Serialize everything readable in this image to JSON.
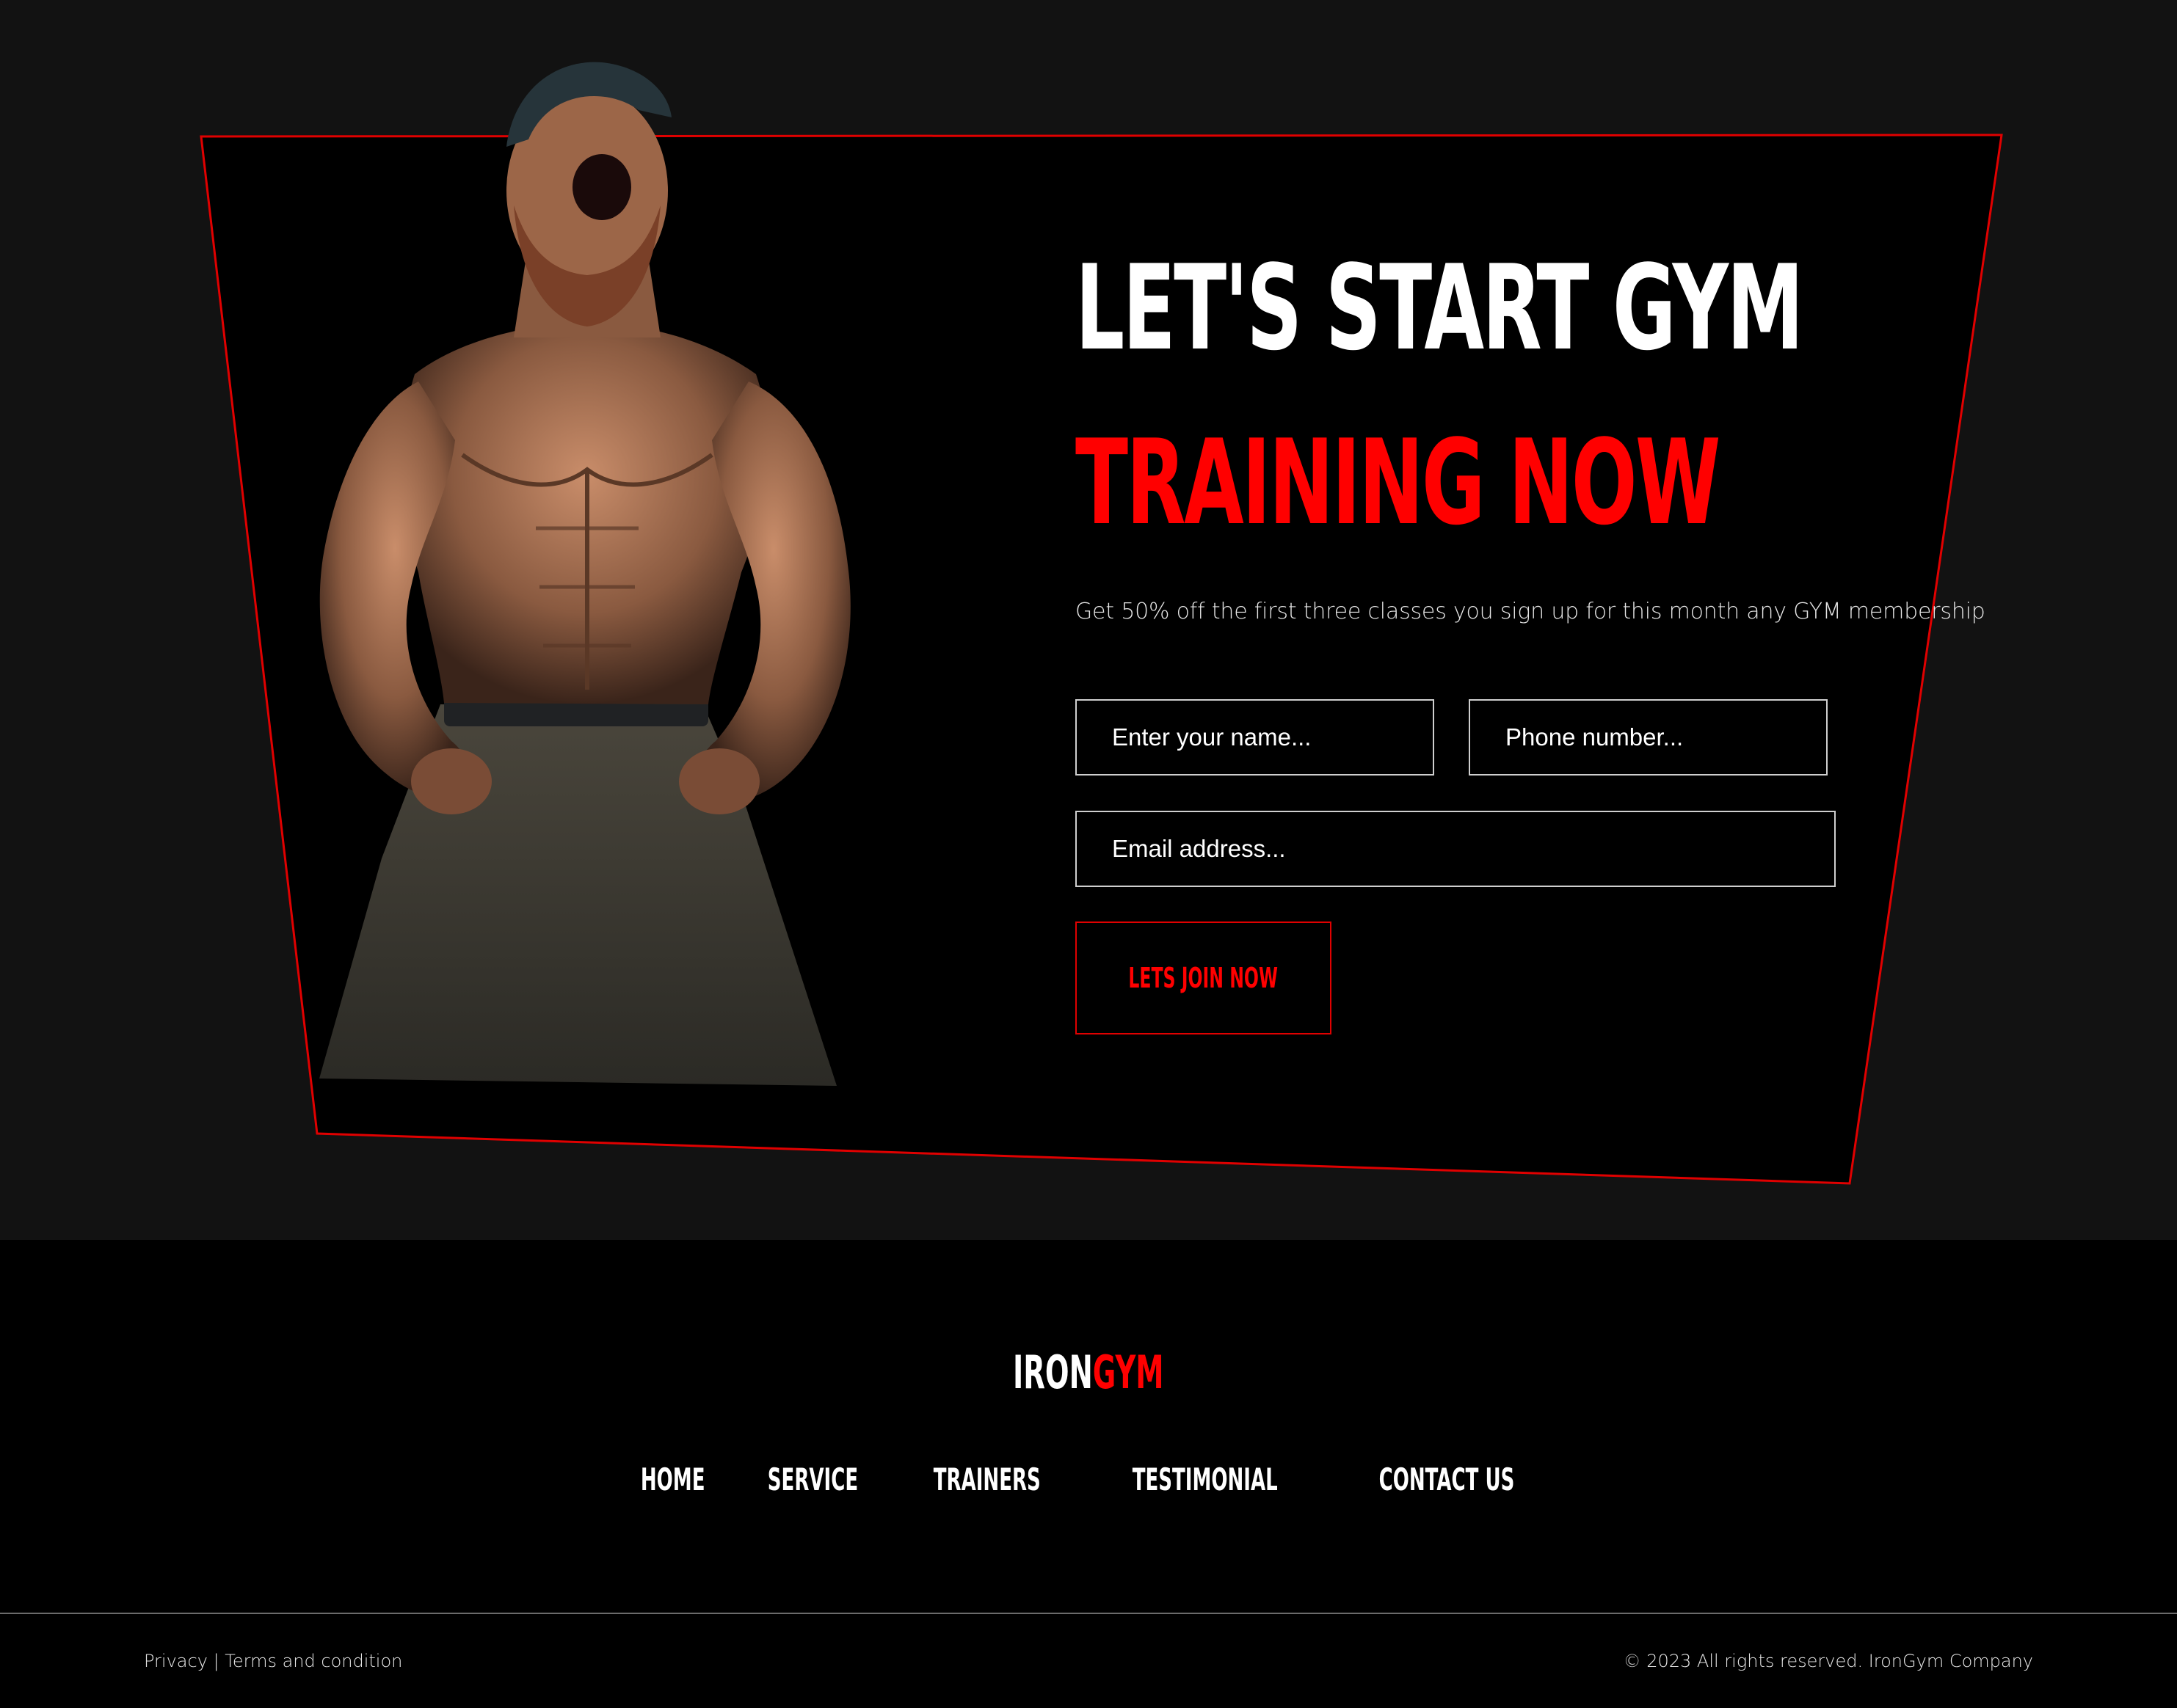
{
  "colors": {
    "accent": "#ff0000",
    "frame_stroke": "#e00000",
    "panel": "#000000",
    "page_bg": "#121212",
    "text": "#ffffff"
  },
  "hero": {
    "title_line_1": "LET'S START GYM",
    "title_line_2": "TRAINING NOW",
    "subtitle": "Get 50% off the first three classes you sign up for this month any GYM membership",
    "image_icon": "athlete-photo",
    "form": {
      "name_placeholder": "Enter your name...",
      "phone_placeholder": "Phone number...",
      "email_placeholder": "Email address...",
      "submit_label": "LETS JOIN NOW"
    }
  },
  "footer": {
    "brand_part_1": "IRON",
    "brand_part_2": "GYM",
    "nav": [
      {
        "label": "HOME"
      },
      {
        "label": "SERVICE"
      },
      {
        "label": "TRAINERS"
      },
      {
        "label": "TESTIMONIAL"
      },
      {
        "label": "CONTACT US"
      }
    ],
    "legal_privacy": "Privacy",
    "legal_separator": "|",
    "legal_terms": "Terms and condition",
    "copyright_icon": "copyright-icon",
    "copyright_text": "2023 All rights reserved. IronGym Company"
  }
}
